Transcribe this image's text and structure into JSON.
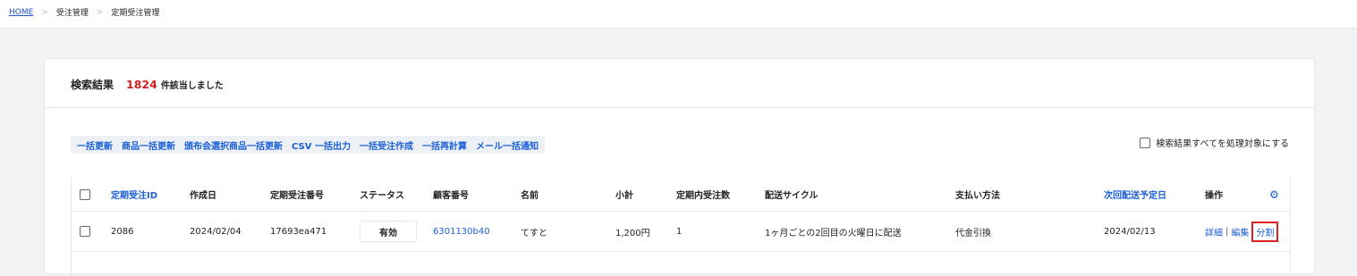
{
  "breadcrumb": [
    "HOME",
    "受注管理",
    "定期受注管理"
  ],
  "results": {
    "label": "検索結果",
    "count": "1824",
    "suffix": "件該当しました"
  },
  "bulk_actions": [
    "一括更新",
    "商品一括更新",
    "頒布会選択商品一括更新",
    "CSV 一括出力",
    "一括受注作成",
    "一括再計算",
    "メール一括通知"
  ],
  "select_all_label": "検索結果すべてを処理対象にする",
  "table": {
    "headers": [
      "定期受注ID",
      "作成日",
      "定期受注番号",
      "ステータス",
      "顧客番号",
      "名前",
      "小計",
      "定期内受注数",
      "配送サイクル",
      "支払い方法",
      "次回配送予定日",
      "操作"
    ],
    "rows": [
      {
        "id": "2086",
        "created": "2024/02/04",
        "order_no": "17693ea471",
        "status": "有効",
        "customer_no": "6301130b40",
        "name": "てすと",
        "subtotal": "1,200円",
        "count": "1",
        "cycle": "1ヶ月ごとの2回目の火曜日に配送",
        "payment": "代金引換",
        "next_date": "2024/02/13",
        "op_detail": "詳細",
        "op_sep": "|",
        "op_edit": "編集",
        "op_split": "分割"
      }
    ]
  },
  "colors": {
    "accent": "#1a5fd6",
    "count": "#d02020",
    "highlight": "#e02020"
  },
  "icons": {
    "settings": "gear-icon"
  }
}
